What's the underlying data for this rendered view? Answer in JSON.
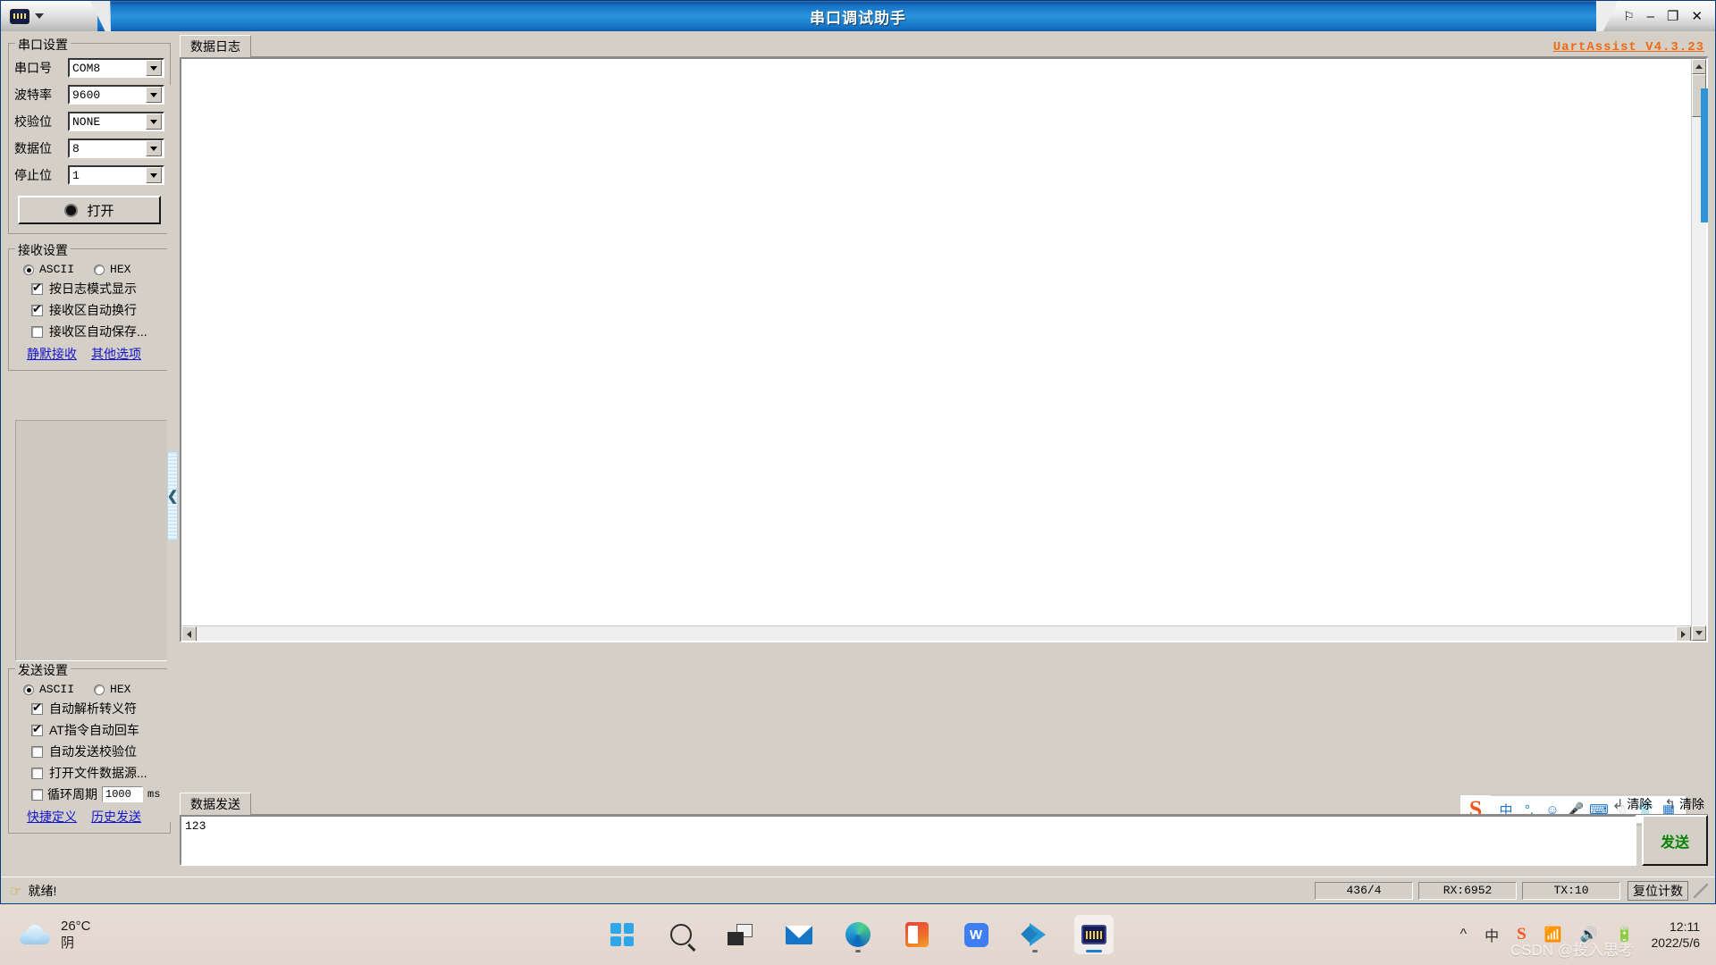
{
  "window": {
    "title": "串口调试助手",
    "logo_icon": "serial-port-icon",
    "dropdown_icon": "chevron-down-icon",
    "pin_label": "⚐",
    "minimize_label": "–",
    "maximize_label": "❐",
    "close_label": "✕"
  },
  "serial_settings": {
    "title": "串口设置",
    "fields": [
      {
        "label": "串口号",
        "value": "COM8"
      },
      {
        "label": "波特率",
        "value": "9600"
      },
      {
        "label": "校验位",
        "value": "NONE"
      },
      {
        "label": "数据位",
        "value": "8"
      },
      {
        "label": "停止位",
        "value": "1"
      }
    ],
    "open_button": "打开"
  },
  "receive_settings": {
    "title": "接收设置",
    "mode_ascii": "ASCII",
    "mode_hex": "HEX",
    "selected_mode": "ASCII",
    "checkboxes": [
      {
        "label": "按日志模式显示",
        "checked": true
      },
      {
        "label": "接收区自动换行",
        "checked": true
      },
      {
        "label": "接收区自动保存...",
        "checked": false
      }
    ],
    "links": [
      "静默接收",
      "其他选项"
    ]
  },
  "send_settings": {
    "title": "发送设置",
    "mode_ascii": "ASCII",
    "mode_hex": "HEX",
    "selected_mode": "ASCII",
    "checkboxes": [
      {
        "label": "自动解析转义符",
        "checked": true
      },
      {
        "label": "AT指令自动回车",
        "checked": true
      },
      {
        "label": "自动发送校验位",
        "checked": false
      },
      {
        "label": "打开文件数据源...",
        "checked": false
      }
    ],
    "cycle": {
      "label": "循环周期",
      "checked": false,
      "value": "1000",
      "unit": "ms"
    },
    "links": [
      "快捷定义",
      "历史发送"
    ]
  },
  "main": {
    "log_tab": "数据日志",
    "version_label": "UartAssist V4.3.23",
    "log_content": "",
    "splitter_icon": "collapse-left-icon"
  },
  "send_area": {
    "tab": "数据发送",
    "input_value": "123",
    "send_button": "发送",
    "clear_receive": {
      "label": "清除",
      "icon": "arrow-down-left-icon"
    },
    "clear_send": {
      "label": "清除",
      "icon": "arrow-up-left-icon"
    }
  },
  "status_bar": {
    "hand_icon": "pointing-hand-icon",
    "status_text": "就绪!",
    "cells": [
      "436/4",
      "RX:6952",
      "TX:10"
    ],
    "reset_button": "复位计数"
  },
  "ime_bar": {
    "logo": "S",
    "items": [
      {
        "icon": "chinese-mode-icon",
        "glyph": "中"
      },
      {
        "icon": "punctuation-icon",
        "glyph": "˚,"
      },
      {
        "icon": "emoji-icon",
        "glyph": "☺"
      },
      {
        "icon": "microphone-icon",
        "glyph": "Ἲ4"
      },
      {
        "icon": "soft-keyboard-icon",
        "glyph": "⌨"
      },
      {
        "icon": "user-account-icon",
        "glyph": "⚬"
      },
      {
        "icon": "skin-shirt-icon",
        "glyph": "☂"
      },
      {
        "icon": "app-grid-icon",
        "glyph": "☰"
      }
    ]
  },
  "taskbar": {
    "weather": {
      "temperature": "26°C",
      "condition": "阴",
      "icon": "cloud-icon"
    },
    "apps": [
      {
        "name": "start-button",
        "active": false
      },
      {
        "name": "search-button",
        "active": false
      },
      {
        "name": "task-view-button",
        "active": false
      },
      {
        "name": "mail-app",
        "active": false
      },
      {
        "name": "edge-browser",
        "active": false
      },
      {
        "name": "office-app",
        "active": false
      },
      {
        "name": "wps-office",
        "active": false
      },
      {
        "name": "vscode-app",
        "active": false
      },
      {
        "name": "serial-assistant-app",
        "active": true
      }
    ],
    "tray": {
      "overflow_icon": "chevron-up-icon",
      "ime_mode": "中",
      "sogou": "S",
      "wifi_icon": "wifi-icon",
      "volume_icon": "speaker-icon",
      "battery_icon": "battery-charging-icon"
    },
    "clock": {
      "time": "12:11",
      "date": "2022/5/6"
    },
    "watermark": "CSDN @投入思考"
  }
}
